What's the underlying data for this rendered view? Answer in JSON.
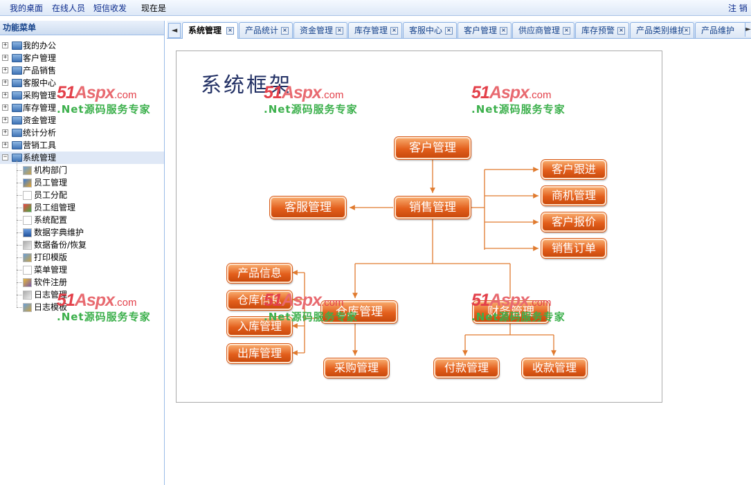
{
  "topbar": {
    "links": [
      "我的桌面",
      "在线人员",
      "短信收发"
    ],
    "now_label": "现在是",
    "logout_label": "注 销"
  },
  "menu": {
    "header": "功能菜单",
    "groups": [
      "我的办公",
      "客户管理",
      "产品销售",
      "客服中心",
      "采购管理",
      "库存管理",
      "资金管理",
      "统计分析",
      "营销工具",
      "系统管理"
    ],
    "expanded_group": "系统管理",
    "system_items": [
      "机构部门",
      "员工管理",
      "员工分配",
      "员工组管理",
      "系统配置",
      "数据字典维护",
      "数据备份/恢复",
      "打印模版",
      "菜单管理",
      "软件注册",
      "日志管理",
      "日志模板"
    ]
  },
  "tabs": {
    "items": [
      "系统管理",
      "产品统计",
      "资金管理",
      "库存管理",
      "客服中心",
      "客户管理",
      "供应商管理",
      "库存预警",
      "产品类别维护",
      "产品维护"
    ],
    "active": "系统管理",
    "close_symbol": "×",
    "scroll_left": "◄",
    "scroll_right": "►"
  },
  "diagram": {
    "title": "系统框架",
    "nodes": {
      "customer": "客户管理",
      "sales": "销售管理",
      "service": "客服管理",
      "follow": "客户跟进",
      "opportunity": "商机管理",
      "quote": "客户报价",
      "order": "销售订单",
      "warehouse": "仓库管理",
      "finance": "财务管理",
      "product_info": "产品信息",
      "warehouse_info": "仓库信息",
      "stock_in": "入库管理",
      "stock_out": "出库管理",
      "purchase": "采购管理",
      "payment": "付款管理",
      "receipt": "收款管理"
    }
  },
  "watermark": {
    "logo_num": "51",
    "logo_aspx": "Aspx",
    "logo_com": ".com",
    "sub": ".Net源码服务专家"
  },
  "colors": {
    "node_orange": "#e35f1c",
    "connector": "#e07a2e",
    "title_navy": "#223064",
    "panel_border": "#99bbe8",
    "watermark_red": "#e3404a",
    "watermark_green": "#3cb04c"
  }
}
